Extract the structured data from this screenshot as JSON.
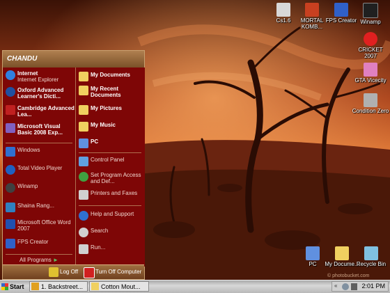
{
  "desktop": {
    "icons": [
      {
        "label": "Cs1.6",
        "icon": "cs-icon",
        "color": "#d8d8d8"
      },
      {
        "label": "MORTAL KOMB...",
        "icon": "mortal-kombat-icon",
        "color": "#c84020"
      },
      {
        "label": "FPS Creator",
        "icon": "fps-creator-icon",
        "color": "#3060c8"
      },
      {
        "label": "Winamp",
        "icon": "winamp-icon",
        "color": "#202020"
      },
      {
        "label": "CRICKET 2007",
        "icon": "cricket-icon",
        "color": "#e02020"
      },
      {
        "label": "GTA Vicecity",
        "icon": "gta-icon",
        "color": "#e080c0"
      },
      {
        "label": "Condition Zero",
        "icon": "condition-zero-icon",
        "color": "#b0b0b0"
      },
      {
        "label": "PC",
        "icon": "computer-icon",
        "color": "#6090e0"
      },
      {
        "label": "My Docume...",
        "icon": "documents-folder-icon",
        "color": "#f0d060"
      },
      {
        "label": "Recycle Bin",
        "icon": "recycle-bin-icon",
        "color": "#80c0e0"
      }
    ],
    "watermark": "© photobucket.com"
  },
  "start_menu": {
    "user": "CHANDU",
    "pinned": [
      {
        "title": "Internet",
        "subtitle": "Internet Explorer",
        "icon": "internet-explorer-icon",
        "color": "#3080e0"
      },
      {
        "title": "Oxford Advanced Learner's Dicti...",
        "subtitle": "",
        "icon": "oxford-dictionary-icon",
        "color": "#2050a0"
      },
      {
        "title": "Cambridge Advanced Lea...",
        "subtitle": "",
        "icon": "cambridge-dictionary-icon",
        "color": "#c02020"
      }
    ],
    "recent": [
      {
        "title": "Microsoft Visual Basic 2008 Exp...",
        "icon": "visual-basic-icon",
        "color": "#8060c0"
      },
      {
        "title": "Windows",
        "icon": "windows-icon",
        "color": "#3070d0"
      },
      {
        "title": "Total Video Player",
        "icon": "video-player-icon",
        "color": "#2060c0"
      },
      {
        "title": "Winamp",
        "icon": "winamp-icon",
        "color": "#404040"
      },
      {
        "title": "Shaina Rang...",
        "icon": "app-icon",
        "color": "#3080c0"
      },
      {
        "title": "Microsoft Office Word 2007",
        "icon": "word-icon",
        "color": "#2050b0"
      },
      {
        "title": "FPS Creator",
        "icon": "fps-creator-icon",
        "color": "#3060c8"
      }
    ],
    "all_programs": "All Programs",
    "places": [
      {
        "label": "My Documents",
        "icon": "documents-folder-icon",
        "color": "#f0d060"
      },
      {
        "label": "My Recent Documents",
        "icon": "recent-documents-icon",
        "color": "#f0d060"
      },
      {
        "label": "My Pictures",
        "icon": "pictures-folder-icon",
        "color": "#f0d060"
      },
      {
        "label": "My Music",
        "icon": "music-folder-icon",
        "color": "#f0d060"
      },
      {
        "label": "PC",
        "icon": "computer-icon",
        "color": "#6090e0"
      }
    ],
    "settings": [
      {
        "label": "Control Panel",
        "icon": "control-panel-icon",
        "color": "#60a0e0"
      },
      {
        "label": "Set Program Access and Def...",
        "icon": "program-access-icon",
        "color": "#40a040"
      },
      {
        "label": "Printers and Faxes",
        "icon": "printer-icon",
        "color": "#d0d0d0"
      }
    ],
    "help": [
      {
        "label": "Help and Support",
        "icon": "help-icon",
        "color": "#3070d0"
      },
      {
        "label": "Search",
        "icon": "search-icon",
        "color": "#d0d0d0"
      },
      {
        "label": "Run...",
        "icon": "run-icon",
        "color": "#d0d0d0"
      }
    ],
    "footer": {
      "logoff_label": "Log Off",
      "shutdown_label": "Turn Off Computer"
    }
  },
  "taskbar": {
    "start_label": "Start",
    "tasks": [
      {
        "label": "1. Backstreet...",
        "icon": "winamp-icon"
      },
      {
        "label": "Cotton Mout...",
        "icon": "folder-icon"
      }
    ],
    "clock": "2:01 PM"
  },
  "colors": {
    "menu_bg": "#7e0606",
    "menu_header": "#b08050",
    "taskbar": "#c0c0c0"
  }
}
